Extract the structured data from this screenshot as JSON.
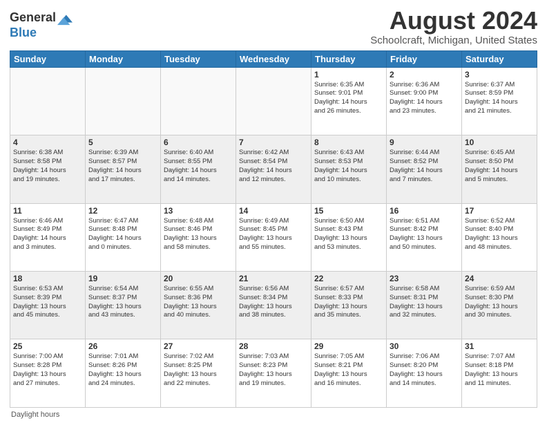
{
  "header": {
    "logo_general": "General",
    "logo_blue": "Blue",
    "main_title": "August 2024",
    "subtitle": "Schoolcraft, Michigan, United States"
  },
  "footer": {
    "daylight_label": "Daylight hours"
  },
  "days_of_week": [
    "Sunday",
    "Monday",
    "Tuesday",
    "Wednesday",
    "Thursday",
    "Friday",
    "Saturday"
  ],
  "weeks": [
    [
      {
        "day": "",
        "info": ""
      },
      {
        "day": "",
        "info": ""
      },
      {
        "day": "",
        "info": ""
      },
      {
        "day": "",
        "info": ""
      },
      {
        "day": "1",
        "info": "Sunrise: 6:35 AM\nSunset: 9:01 PM\nDaylight: 14 hours\nand 26 minutes."
      },
      {
        "day": "2",
        "info": "Sunrise: 6:36 AM\nSunset: 9:00 PM\nDaylight: 14 hours\nand 23 minutes."
      },
      {
        "day": "3",
        "info": "Sunrise: 6:37 AM\nSunset: 8:59 PM\nDaylight: 14 hours\nand 21 minutes."
      }
    ],
    [
      {
        "day": "4",
        "info": "Sunrise: 6:38 AM\nSunset: 8:58 PM\nDaylight: 14 hours\nand 19 minutes."
      },
      {
        "day": "5",
        "info": "Sunrise: 6:39 AM\nSunset: 8:57 PM\nDaylight: 14 hours\nand 17 minutes."
      },
      {
        "day": "6",
        "info": "Sunrise: 6:40 AM\nSunset: 8:55 PM\nDaylight: 14 hours\nand 14 minutes."
      },
      {
        "day": "7",
        "info": "Sunrise: 6:42 AM\nSunset: 8:54 PM\nDaylight: 14 hours\nand 12 minutes."
      },
      {
        "day": "8",
        "info": "Sunrise: 6:43 AM\nSunset: 8:53 PM\nDaylight: 14 hours\nand 10 minutes."
      },
      {
        "day": "9",
        "info": "Sunrise: 6:44 AM\nSunset: 8:52 PM\nDaylight: 14 hours\nand 7 minutes."
      },
      {
        "day": "10",
        "info": "Sunrise: 6:45 AM\nSunset: 8:50 PM\nDaylight: 14 hours\nand 5 minutes."
      }
    ],
    [
      {
        "day": "11",
        "info": "Sunrise: 6:46 AM\nSunset: 8:49 PM\nDaylight: 14 hours\nand 3 minutes."
      },
      {
        "day": "12",
        "info": "Sunrise: 6:47 AM\nSunset: 8:48 PM\nDaylight: 14 hours\nand 0 minutes."
      },
      {
        "day": "13",
        "info": "Sunrise: 6:48 AM\nSunset: 8:46 PM\nDaylight: 13 hours\nand 58 minutes."
      },
      {
        "day": "14",
        "info": "Sunrise: 6:49 AM\nSunset: 8:45 PM\nDaylight: 13 hours\nand 55 minutes."
      },
      {
        "day": "15",
        "info": "Sunrise: 6:50 AM\nSunset: 8:43 PM\nDaylight: 13 hours\nand 53 minutes."
      },
      {
        "day": "16",
        "info": "Sunrise: 6:51 AM\nSunset: 8:42 PM\nDaylight: 13 hours\nand 50 minutes."
      },
      {
        "day": "17",
        "info": "Sunrise: 6:52 AM\nSunset: 8:40 PM\nDaylight: 13 hours\nand 48 minutes."
      }
    ],
    [
      {
        "day": "18",
        "info": "Sunrise: 6:53 AM\nSunset: 8:39 PM\nDaylight: 13 hours\nand 45 minutes."
      },
      {
        "day": "19",
        "info": "Sunrise: 6:54 AM\nSunset: 8:37 PM\nDaylight: 13 hours\nand 43 minutes."
      },
      {
        "day": "20",
        "info": "Sunrise: 6:55 AM\nSunset: 8:36 PM\nDaylight: 13 hours\nand 40 minutes."
      },
      {
        "day": "21",
        "info": "Sunrise: 6:56 AM\nSunset: 8:34 PM\nDaylight: 13 hours\nand 38 minutes."
      },
      {
        "day": "22",
        "info": "Sunrise: 6:57 AM\nSunset: 8:33 PM\nDaylight: 13 hours\nand 35 minutes."
      },
      {
        "day": "23",
        "info": "Sunrise: 6:58 AM\nSunset: 8:31 PM\nDaylight: 13 hours\nand 32 minutes."
      },
      {
        "day": "24",
        "info": "Sunrise: 6:59 AM\nSunset: 8:30 PM\nDaylight: 13 hours\nand 30 minutes."
      }
    ],
    [
      {
        "day": "25",
        "info": "Sunrise: 7:00 AM\nSunset: 8:28 PM\nDaylight: 13 hours\nand 27 minutes."
      },
      {
        "day": "26",
        "info": "Sunrise: 7:01 AM\nSunset: 8:26 PM\nDaylight: 13 hours\nand 24 minutes."
      },
      {
        "day": "27",
        "info": "Sunrise: 7:02 AM\nSunset: 8:25 PM\nDaylight: 13 hours\nand 22 minutes."
      },
      {
        "day": "28",
        "info": "Sunrise: 7:03 AM\nSunset: 8:23 PM\nDaylight: 13 hours\nand 19 minutes."
      },
      {
        "day": "29",
        "info": "Sunrise: 7:05 AM\nSunset: 8:21 PM\nDaylight: 13 hours\nand 16 minutes."
      },
      {
        "day": "30",
        "info": "Sunrise: 7:06 AM\nSunset: 8:20 PM\nDaylight: 13 hours\nand 14 minutes."
      },
      {
        "day": "31",
        "info": "Sunrise: 7:07 AM\nSunset: 8:18 PM\nDaylight: 13 hours\nand 11 minutes."
      }
    ]
  ]
}
